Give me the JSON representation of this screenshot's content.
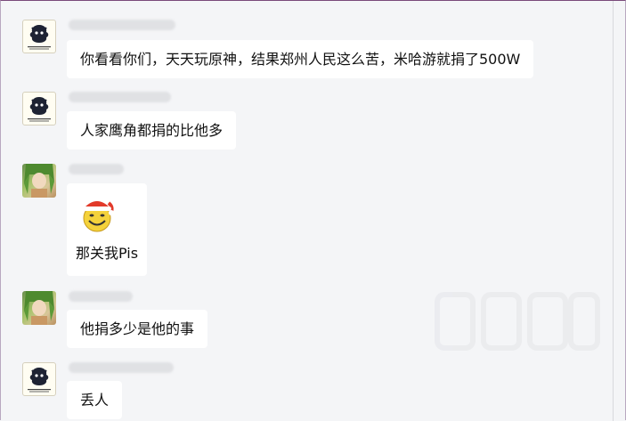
{
  "messages": [
    {
      "sender": "user-a",
      "text": "你看看你们，天天玩原神，结果郑州人民这么苦，米哈游就捐了500W"
    },
    {
      "sender": "user-a",
      "text": "人家鹰角都捐的比他多"
    },
    {
      "sender": "user-b",
      "text": "那关我Pis",
      "emoji": "santa-hat-smiley"
    },
    {
      "sender": "user-b",
      "text": "他捐多少是他的事"
    },
    {
      "sender": "user-a",
      "text": "丢人"
    }
  ],
  "colors": {
    "background": "#f4f5f7",
    "bubble": "#ffffff",
    "text": "#111111",
    "window_border": "#7a4a7a"
  },
  "icons": {
    "avatar_a": "dark-creature-avatar",
    "avatar_b": "green-hair-character-avatar",
    "emoji": "santa-hat-smiley-icon"
  }
}
